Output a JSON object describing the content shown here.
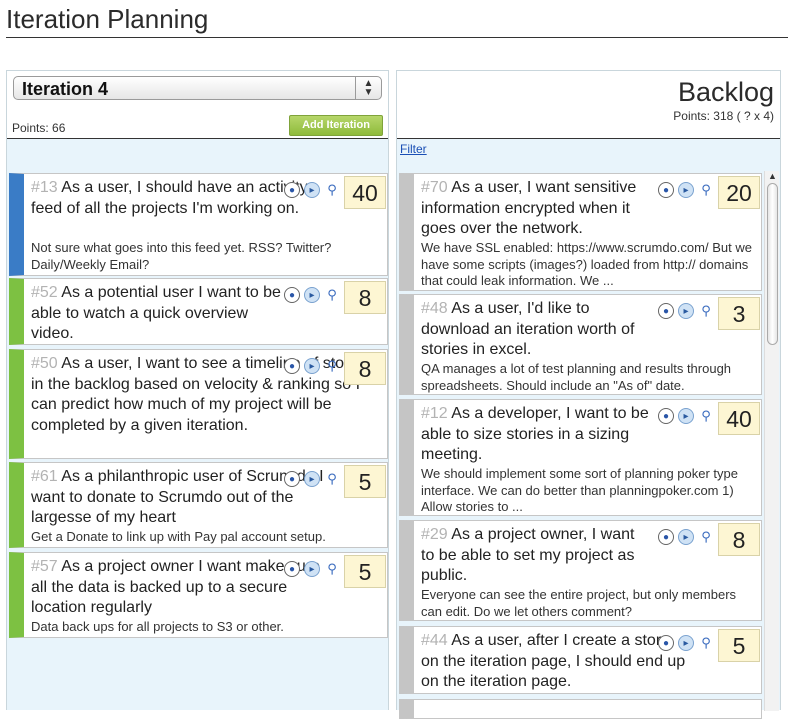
{
  "page": {
    "title": "Iteration Planning"
  },
  "iteration": {
    "selected": "Iteration 4",
    "points_label": "Points: 66",
    "add_button": "Add Iteration",
    "stories": [
      {
        "num": "#13",
        "title": "As a user, I should have an activity feed of all the projects I'm working on.",
        "detail": "Not sure what goes into this feed yet. RSS? Twitter? Daily/Weekly Email?",
        "points": "40",
        "color": "#3a7cc6"
      },
      {
        "num": "#52",
        "title": "As a potential user I want to be able to watch a quick overview video.",
        "detail": "",
        "points": "8",
        "color": "#7dc142"
      },
      {
        "num": "#50",
        "title": "As a user, I want to see a timeline of stories in the backlog based on velocity & ranking so I can predict how much of my project will be completed by a given iteration.",
        "detail": "",
        "points": "8",
        "color": "#7dc142"
      },
      {
        "num": "#61",
        "title": "As a philanthropic user of Scrum do I want to donate to Scrumdo out of the largesse of my heart",
        "detail": "Get a Donate to link up with Pay pal account setup.",
        "points": "5",
        "color": "#7dc142"
      },
      {
        "num": "#57",
        "title": "As a project owner I want make sure all the data is backed up to a secure location regularly",
        "detail": "Data back ups for all projects to S3 or other.",
        "points": "5",
        "color": "#7dc142"
      }
    ]
  },
  "backlog": {
    "title": "Backlog",
    "points_label": "Points: 318 ( ? x 4)",
    "filter_label": "Filter",
    "stories": [
      {
        "num": "#70",
        "title": "As a user, I want sensitive information encrypted when it goes over the network.",
        "detail": "We have SSL enabled: https://www.scrumdo.com/ But we have some scripts (images?) loaded from http:// domains that could leak information. We ...",
        "points": "20"
      },
      {
        "num": "#48",
        "title": "As a user, I'd like to download an iteration worth of stories in excel.",
        "detail": "QA manages a lot of test planning and results through spreadsheets. Should include an \"As of\" date.",
        "points": "3"
      },
      {
        "num": "#12",
        "title": "As a developer, I want to be able to size stories in a sizing meeting.",
        "detail": "We should implement some sort of planning poker type interface. We can do better than planningpoker.com 1) Allow stories to ...",
        "points": "40"
      },
      {
        "num": "#29",
        "title": "As a project owner, I want to be able to set my project as public.",
        "detail": "Everyone can see the entire project, but only members can edit. Do we let others comment?",
        "points": "8"
      },
      {
        "num": "#44",
        "title": "As a user, after I create a story on the iteration page, I should end up on the iteration page.",
        "detail": "",
        "points": "5"
      }
    ]
  },
  "icons": {
    "view": "eye-icon",
    "move": "play-icon",
    "details": "magnifier-icon"
  }
}
